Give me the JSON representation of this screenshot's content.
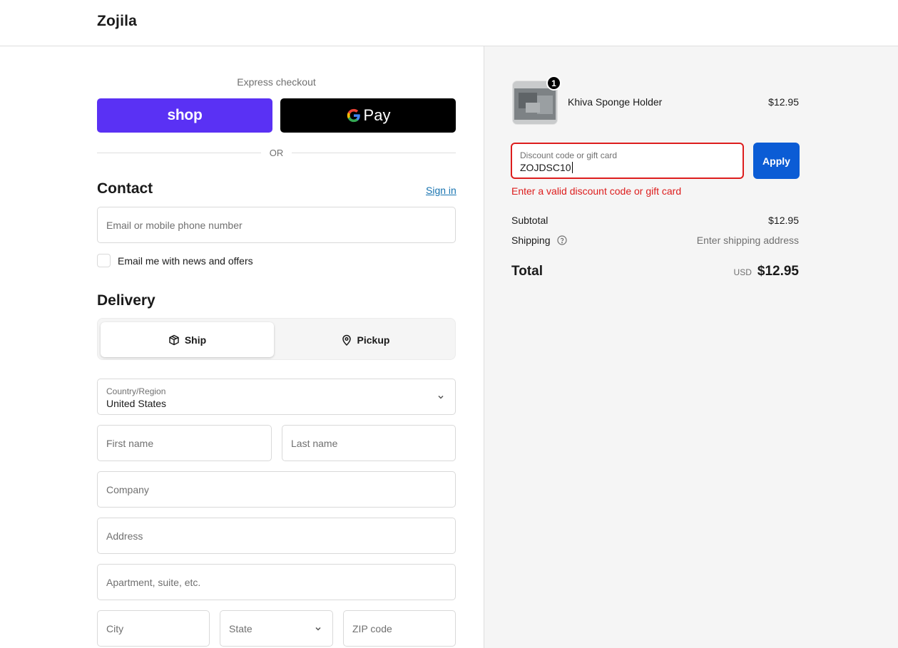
{
  "header": {
    "brand": "Zojila"
  },
  "express": {
    "label": "Express checkout",
    "shop_label": "shop",
    "gpay_label": "Pay",
    "or_label": "OR"
  },
  "contact": {
    "title": "Contact",
    "sign_in": "Sign in",
    "email_placeholder": "Email or mobile phone number",
    "newsletter_label": "Email me with news and offers",
    "newsletter_checked": false
  },
  "delivery": {
    "title": "Delivery",
    "tab_ship": "Ship",
    "tab_pickup": "Pickup",
    "active_tab": "Ship",
    "country_label": "Country/Region",
    "country_value": "United States",
    "first_name_placeholder": "First name",
    "last_name_placeholder": "Last name",
    "company_placeholder": "Company",
    "address_placeholder": "Address",
    "apartment_placeholder": "Apartment, suite, etc.",
    "city_placeholder": "City",
    "state_placeholder": "State",
    "zip_placeholder": "ZIP code"
  },
  "summary": {
    "product": {
      "name": "Khiva Sponge Holder",
      "price": "$12.95",
      "quantity": "1"
    },
    "discount": {
      "label": "Discount code or gift card",
      "value": "ZOJDSC10",
      "apply_label": "Apply",
      "error": "Enter a valid discount code or gift card"
    },
    "subtotal_label": "Subtotal",
    "subtotal_value": "$12.95",
    "shipping_label": "Shipping",
    "shipping_value": "Enter shipping address",
    "total_label": "Total",
    "total_currency": "USD",
    "total_value": "$12.95"
  },
  "colors": {
    "shop_purple": "#5a31f4",
    "apply_blue": "#0b5cd5",
    "error_red": "#dd1d1d",
    "link_blue": "#1773b0"
  }
}
